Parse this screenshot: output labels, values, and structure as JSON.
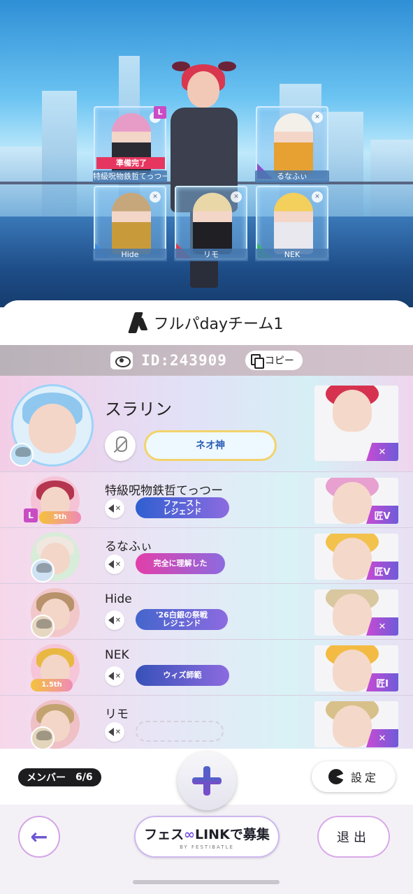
{
  "lobby": {
    "slots": [
      {
        "name": "特級呪物鉄哲てっつー",
        "status": "準備完了",
        "leader_mark": "L",
        "hair": "#e79cc8",
        "outfit": "#2b2b33"
      },
      {
        "name": "るなふぃ",
        "status": "",
        "leader_mark": "",
        "hair": "#f3f0ea",
        "outfit": "#e6a132"
      },
      {
        "name": "Hide",
        "status": "",
        "leader_mark": "",
        "hair": "#c6a77b",
        "outfit": "#c99a3a"
      },
      {
        "name": "リモ",
        "status": "",
        "leader_mark": "",
        "hair": "#e9d7a8",
        "outfit": "#1f1f24"
      },
      {
        "name": "NEK",
        "status": "",
        "leader_mark": "",
        "hair": "#f3cf5c",
        "outfit": "#e8e8ee"
      }
    ]
  },
  "team": {
    "name": "フルパdayチーム1",
    "id_label": "ID:243909",
    "copy_label": "コピー"
  },
  "members": [
    {
      "name": "スラリン",
      "title": "ネオ神",
      "rank": "✕",
      "is_host": true,
      "hair": "#8fc7ef",
      "portrait_hair": "#d6324f",
      "badge_color": "#4aa6e8"
    },
    {
      "name": "特級呪物鉄哲てっつー",
      "title": "ファースト\nレジェンド",
      "rank": "匠V",
      "leader_mark": "L",
      "anniversary": "5th",
      "hair": "#b5354f",
      "portrait_hair": "#e7a0cf",
      "badge_color": "#2f5fd0"
    },
    {
      "name": "るなふぃ",
      "title": "完全に理解した",
      "rank": "匠V",
      "hair": "#f0e7e0",
      "portrait_hair": "#f2c24d",
      "badge_color": "#e23fa9"
    },
    {
      "name": "Hide",
      "title": "'26白銀の祭戦\nレジェンド",
      "rank": "✕",
      "hair": "#b7926a",
      "portrait_hair": "#d9c7a0",
      "badge_color": "#4466cc"
    },
    {
      "name": "NEK",
      "title": "ウィズ師範",
      "rank": "匠I",
      "anniversary": "1.5th",
      "hair": "#e8b842",
      "portrait_hair": "#f3bb44",
      "badge_color": "#3751b8"
    },
    {
      "name": "リモ",
      "title": "",
      "rank": "✕",
      "hair": "#c2a36f",
      "portrait_hair": "#d8c08a",
      "badge_color": ""
    }
  ],
  "footer": {
    "members_label": "メンバー",
    "members_count": "6/6",
    "settings_label": "設定",
    "recruit_label_prefix": "フェス",
    "recruit_label_link": "LINK",
    "recruit_label_suffix": "で募集",
    "recruit_sub": "BY FESTIBATLE",
    "exit_label": "退出",
    "back_symbol": "←"
  },
  "colors": {
    "accent_purple": "#6d58d2",
    "rank_gradient_start": "#c84bd4",
    "ready_red": "#e6365f",
    "id_bar": "#c2b7bf"
  }
}
